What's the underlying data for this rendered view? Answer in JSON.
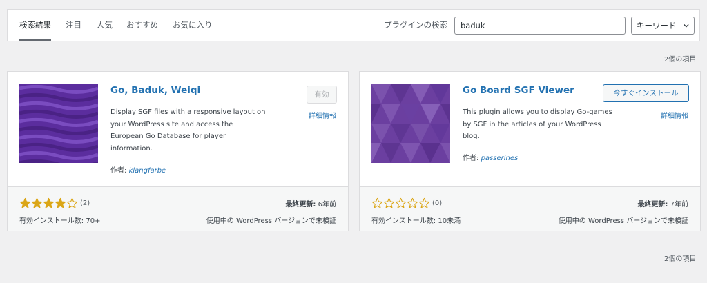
{
  "tabs": [
    {
      "label": "検索結果"
    },
    {
      "label": "注目"
    },
    {
      "label": "人気"
    },
    {
      "label": "おすすめ"
    },
    {
      "label": "お気に入り"
    }
  ],
  "search": {
    "label": "プラグインの検索",
    "value": "baduk",
    "type_selected": "キーワード"
  },
  "results_count": "2個の項目",
  "plugins": [
    {
      "name": "Go, Baduk, Weiqi",
      "description": "Display SGF files with a responsive layout on your WordPress site and access the European Go Database for player information.",
      "author_label": "作者:",
      "author": "klangfarbe",
      "action_label": "有効",
      "details_label": "詳細情報",
      "rating": 4,
      "rating_count": "(2)",
      "last_updated_label": "最終更新:",
      "last_updated": "6年前",
      "installs": "有効インストール数: 70+",
      "compat": "使用中の WordPress バージョンで未検証"
    },
    {
      "name": "Go Board SGF Viewer",
      "description": "This plugin allows you to display Go-games by SGF in the articles of your WordPress blog.",
      "author_label": "作者:",
      "author": "passerines",
      "action_label": "今すぐインストール",
      "details_label": "詳細情報",
      "rating": 0,
      "rating_count": "(0)",
      "last_updated_label": "最終更新:",
      "last_updated": "7年前",
      "installs": "有効インストール数: 10未満",
      "compat": "使用中の WordPress バージョンで未検証"
    }
  ],
  "colors": {
    "link": "#2271b1",
    "star": "#dba617",
    "thumb_purple": "#6b3fa0"
  }
}
